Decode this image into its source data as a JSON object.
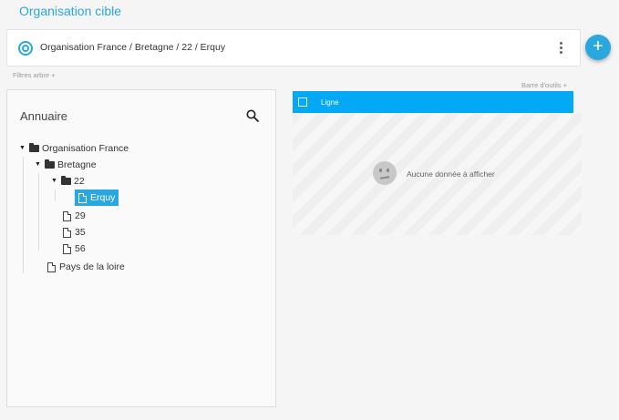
{
  "page": {
    "title": "Organisation cible"
  },
  "target": {
    "path": "Organisation France / Bretagne / 22 / Erquy"
  },
  "links": {
    "filters": "Filtres arbre +",
    "toolbar": "Barre d'outils +"
  },
  "fab": {
    "label": "+"
  },
  "directory": {
    "title": "Annuaire",
    "tree": [
      {
        "label": "Organisation France",
        "type": "folder",
        "expanded": true,
        "level": 0
      },
      {
        "label": "Bretagne",
        "type": "folder",
        "expanded": true,
        "level": 1
      },
      {
        "label": "22",
        "type": "folder",
        "expanded": true,
        "level": 2
      },
      {
        "label": "Erquy",
        "type": "file",
        "selected": true,
        "level": 3
      },
      {
        "label": "29",
        "type": "file",
        "level": 2
      },
      {
        "label": "35",
        "type": "file",
        "level": 2
      },
      {
        "label": "56",
        "type": "file",
        "level": 2
      },
      {
        "label": "Pays de la loire",
        "type": "file",
        "level": 1
      }
    ]
  },
  "grid": {
    "column": "Ligne",
    "empty_message": "Aucune donnée à afficher"
  },
  "colors": {
    "accent": "#29a7df",
    "header": "#03a9f4"
  }
}
